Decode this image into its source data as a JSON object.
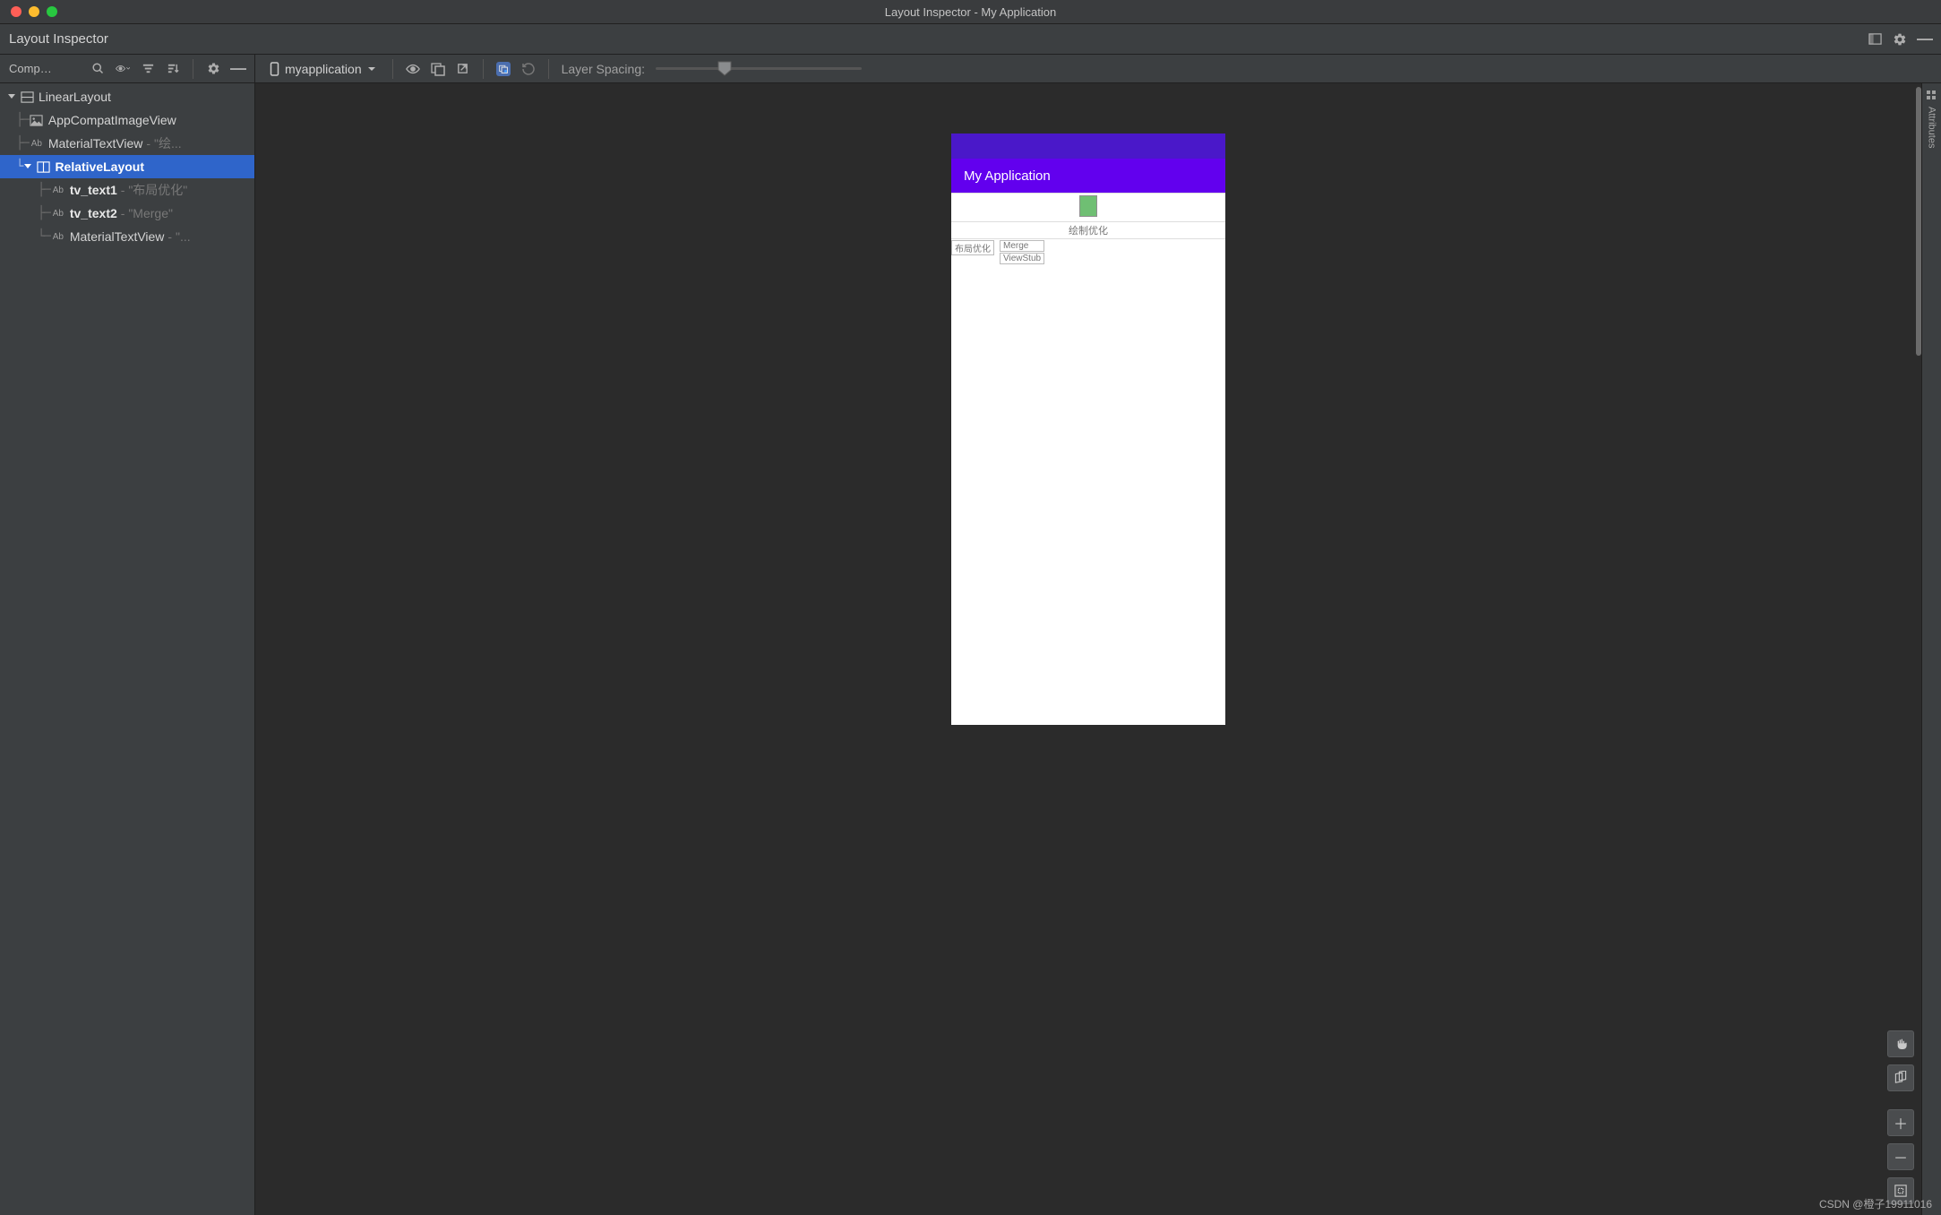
{
  "window": {
    "title": "Layout Inspector - My Application"
  },
  "panel": {
    "title": "Layout Inspector"
  },
  "componentTreeLabel": "Compo...",
  "process": {
    "name": "myapplication"
  },
  "layerSpacingLabel": "Layer Spacing:",
  "tree": {
    "n0": {
      "name": "LinearLayout"
    },
    "n1": {
      "name": "AppCompatImageView"
    },
    "n2": {
      "name": "MaterialTextView",
      "suffix": " - \"绘..."
    },
    "n3": {
      "name": "RelativeLayout"
    },
    "n4": {
      "name": "tv_text1",
      "suffix": " - \"布局优化\""
    },
    "n5": {
      "name": "tv_text2",
      "suffix": " - \"Merge\""
    },
    "n6": {
      "name": "MaterialTextView",
      "suffix": " - \"..."
    }
  },
  "abLabel": "Ab",
  "device": {
    "appTitle": "My Application",
    "label1": "绘制优化",
    "cell1": "布局优化",
    "cell2": "Merge",
    "cell3": "ViewStub"
  },
  "rightRail": {
    "label": "Attributes"
  },
  "watermark": "CSDN @橙子19911016"
}
